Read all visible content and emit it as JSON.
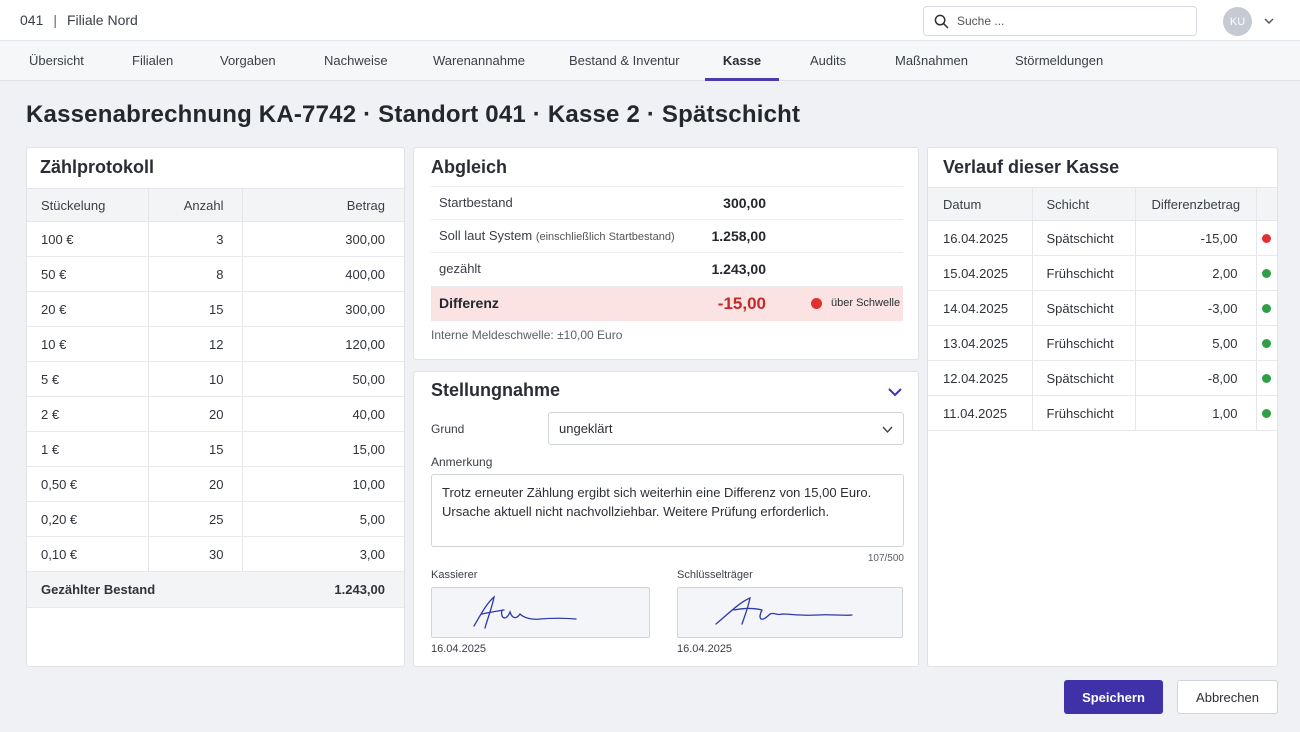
{
  "header": {
    "branch_code": "041",
    "separator": "|",
    "branch_name": "Filiale Nord",
    "search_placeholder": "Suche ...",
    "user_initials": "KU"
  },
  "nav": {
    "items": [
      {
        "label": "Übersicht",
        "active": false
      },
      {
        "label": "Filialen",
        "active": false
      },
      {
        "label": "Vorgaben",
        "active": false
      },
      {
        "label": "Nachweise",
        "active": false
      },
      {
        "label": "Warenannahme",
        "active": false
      },
      {
        "label": "Bestand & Inventur",
        "active": false
      },
      {
        "label": "Kasse",
        "active": true
      },
      {
        "label": "Audits",
        "active": false
      },
      {
        "label": "Maßnahmen",
        "active": false
      },
      {
        "label": "Störmeldungen",
        "active": false
      }
    ]
  },
  "page_title": "Kassenabrechnung KA-7742 · Standort 041 · Kasse 2 · Spätschicht",
  "count": {
    "title": "Zählprotokoll",
    "headers": [
      "Stückelung",
      "Anzahl",
      "Betrag"
    ],
    "rows": [
      [
        "100 €",
        "3",
        "300,00"
      ],
      [
        "50 €",
        "8",
        "400,00"
      ],
      [
        "20 €",
        "15",
        "300,00"
      ],
      [
        "10 €",
        "12",
        "120,00"
      ],
      [
        "5 €",
        "10",
        "50,00"
      ],
      [
        "2 €",
        "20",
        "40,00"
      ],
      [
        "1 €",
        "15",
        "15,00"
      ],
      [
        "0,50 €",
        "20",
        "10,00"
      ],
      [
        "0,20 €",
        "25",
        "5,00"
      ],
      [
        "0,10 €",
        "30",
        "3,00"
      ]
    ],
    "total_label": "Gezählter Bestand",
    "total_value": "1.243,00"
  },
  "reconciliation": {
    "title": "Abgleich",
    "start_label": "Startbestand",
    "start_value": "300,00",
    "system_label": "Soll laut System",
    "system_note": "(einschließlich Startbestand)",
    "system_value": "1.258,00",
    "counted_label": "gezählt",
    "counted_value": "1.243,00",
    "diff_label": "Differenz",
    "diff_value": "-15,00",
    "diff_status": "über Schwelle",
    "threshold_note": "Interne Meldeschwelle: ±10,00 Euro",
    "colors": {
      "alert": "#e03131",
      "ok": "#2f9e44",
      "diff_bg": "#fbe3e3"
    }
  },
  "statement": {
    "title": "Stellungnahme",
    "reason_label": "Grund",
    "reason_value": "ungeklärt",
    "note_label": "Anmerkung",
    "note_text": "Trotz erneuter Zählung ergibt sich weiterhin eine Differenz von 15,00 Euro.\nUrsache aktuell nicht nachvollziehbar. Weitere Prüfung erforderlich.",
    "char_count": "107/500",
    "cashier_label": "Kassierer",
    "cashier_date": "16.04.2025",
    "keyholder_label": "Schlüsselträger",
    "keyholder_date": "16.04.2025"
  },
  "history": {
    "title": "Verlauf dieser Kasse",
    "headers": [
      "Datum",
      "Schicht",
      "Differenzbetrag",
      ""
    ],
    "rows": [
      {
        "date": "16.04.2025",
        "shift": "Spätschicht",
        "amount": "-15,00",
        "status": "alert"
      },
      {
        "date": "15.04.2025",
        "shift": "Frühschicht",
        "amount": "2,00",
        "status": "ok"
      },
      {
        "date": "14.04.2025",
        "shift": "Spätschicht",
        "amount": "-3,00",
        "status": "ok"
      },
      {
        "date": "13.04.2025",
        "shift": "Frühschicht",
        "amount": "5,00",
        "status": "ok"
      },
      {
        "date": "12.04.2025",
        "shift": "Spätschicht",
        "amount": "-8,00",
        "status": "ok"
      },
      {
        "date": "11.04.2025",
        "shift": "Frühschicht",
        "amount": "1,00",
        "status": "ok"
      }
    ]
  },
  "actions": {
    "save_label": "Speichern",
    "cancel_label": "Abbrechen",
    "primary_color": "#3f32a8"
  }
}
